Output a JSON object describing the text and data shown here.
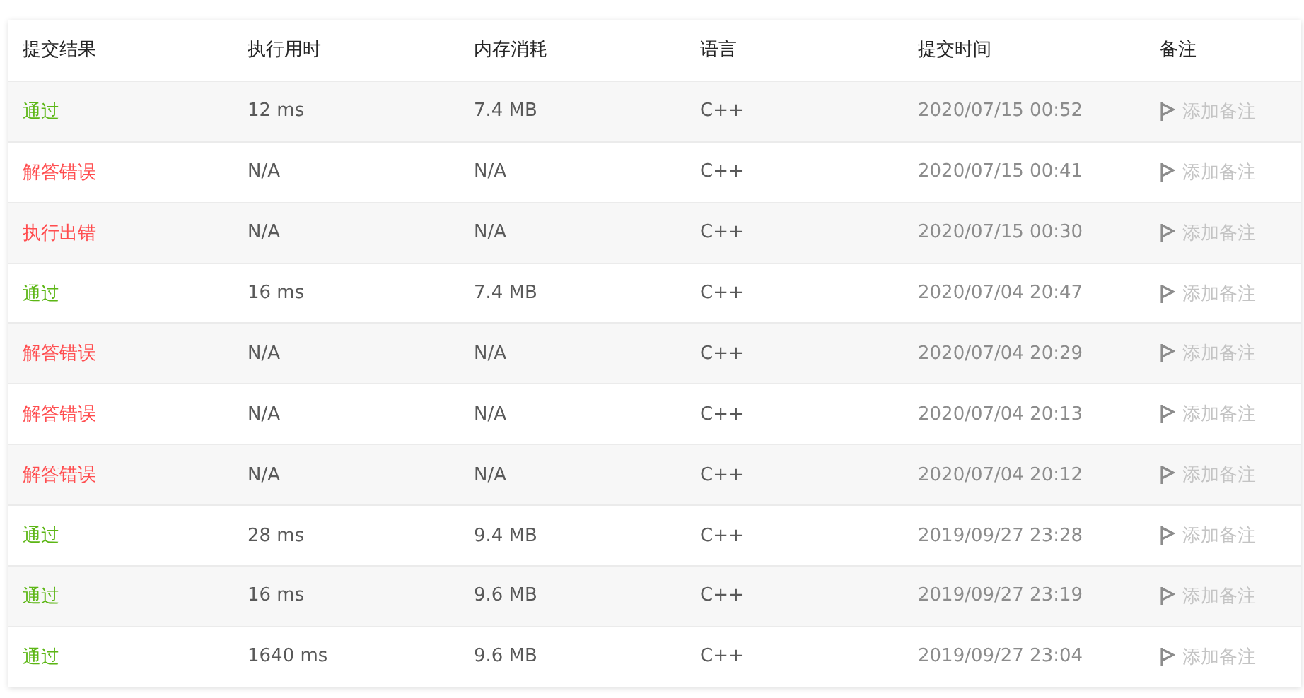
{
  "columns": [
    "提交结果",
    "执行用时",
    "内存消耗",
    "语言",
    "提交时间",
    "备注"
  ],
  "rows": [
    {
      "result": "通过",
      "kind": "pass",
      "time": "12 ms",
      "memory": "7.4 MB",
      "language": "C++",
      "submitted": "2020/07/15 00:52",
      "note": "添加备注"
    },
    {
      "result": "解答错误",
      "kind": "fail",
      "time": "N/A",
      "memory": "N/A",
      "language": "C++",
      "submitted": "2020/07/15 00:41",
      "note": "添加备注"
    },
    {
      "result": "执行出错",
      "kind": "fail",
      "time": "N/A",
      "memory": "N/A",
      "language": "C++",
      "submitted": "2020/07/15 00:30",
      "note": "添加备注"
    },
    {
      "result": "通过",
      "kind": "pass",
      "time": "16 ms",
      "memory": "7.4 MB",
      "language": "C++",
      "submitted": "2020/07/04 20:47",
      "note": "添加备注"
    },
    {
      "result": "解答错误",
      "kind": "fail",
      "time": "N/A",
      "memory": "N/A",
      "language": "C++",
      "submitted": "2020/07/04 20:29",
      "note": "添加备注"
    },
    {
      "result": "解答错误",
      "kind": "fail",
      "time": "N/A",
      "memory": "N/A",
      "language": "C++",
      "submitted": "2020/07/04 20:13",
      "note": "添加备注"
    },
    {
      "result": "解答错误",
      "kind": "fail",
      "time": "N/A",
      "memory": "N/A",
      "language": "C++",
      "submitted": "2020/07/04 20:12",
      "note": "添加备注"
    },
    {
      "result": "通过",
      "kind": "pass",
      "time": "28 ms",
      "memory": "9.4 MB",
      "language": "C++",
      "submitted": "2019/09/27 23:28",
      "note": "添加备注"
    },
    {
      "result": "通过",
      "kind": "pass",
      "time": "16 ms",
      "memory": "9.6 MB",
      "language": "C++",
      "submitted": "2019/09/27 23:19",
      "note": "添加备注"
    },
    {
      "result": "通过",
      "kind": "pass",
      "time": "1640 ms",
      "memory": "9.6 MB",
      "language": "C++",
      "submitted": "2019/09/27 23:04",
      "note": "添加备注"
    }
  ]
}
